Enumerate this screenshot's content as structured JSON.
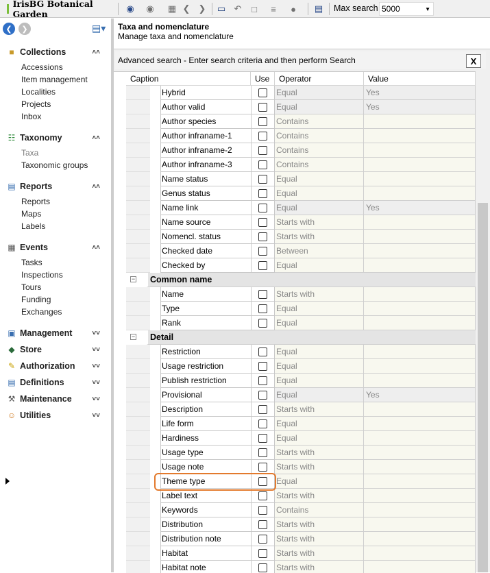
{
  "toolbar": {
    "app_title": "IrisBG Botanical Garden",
    "max_search_label": "Max search",
    "max_search_value": "5000",
    "icons": [
      "find-icon",
      "find-disabled-icon",
      "grid-icon",
      "back-icon",
      "forward-icon",
      "window-icon",
      "undo-icon",
      "save-icon",
      "export-icon",
      "user-icon",
      "settings-icon"
    ]
  },
  "sidebar": {
    "groups": [
      {
        "label": "Collections",
        "expanded": true,
        "items": [
          "Accessions",
          "Item management",
          "Localities",
          "Projects",
          "Inbox"
        ]
      },
      {
        "label": "Taxonomy",
        "expanded": true,
        "items": [
          "Taxa",
          "Taxonomic groups"
        ]
      },
      {
        "label": "Reports",
        "expanded": true,
        "items": [
          "Reports",
          "Maps",
          "Labels"
        ]
      },
      {
        "label": "Events",
        "expanded": true,
        "items": [
          "Tasks",
          "Inspections",
          "Tours",
          "Funding",
          "Exchanges"
        ]
      },
      {
        "label": "Management",
        "expanded": false
      },
      {
        "label": "Store",
        "expanded": false
      },
      {
        "label": "Authorization",
        "expanded": false
      },
      {
        "label": "Definitions",
        "expanded": false
      },
      {
        "label": "Maintenance",
        "expanded": false
      },
      {
        "label": "Utilities",
        "expanded": false
      }
    ]
  },
  "main": {
    "title": "Taxa and nomenclature",
    "subtitle": "Manage taxa and nomenclature",
    "panel_title": "Advanced search - Enter search criteria and then perform Search",
    "close_label": "X"
  },
  "grid": {
    "columns": [
      "Caption",
      "Use",
      "Operator",
      "Value"
    ],
    "rows": [
      {
        "caption": "Hybrid",
        "operator": "Equal",
        "value": "Yes"
      },
      {
        "caption": "Author valid",
        "operator": "Equal",
        "value": "Yes"
      },
      {
        "caption": "Author species",
        "operator": "Contains",
        "value": ""
      },
      {
        "caption": "Author infraname-1",
        "operator": "Contains",
        "value": ""
      },
      {
        "caption": "Author infraname-2",
        "operator": "Contains",
        "value": ""
      },
      {
        "caption": "Author infraname-3",
        "operator": "Contains",
        "value": ""
      },
      {
        "caption": "Name status",
        "operator": "Equal",
        "value": ""
      },
      {
        "caption": "Genus status",
        "operator": "Equal",
        "value": ""
      },
      {
        "caption": "Name link",
        "operator": "Equal",
        "value": "Yes"
      },
      {
        "caption": "Name source",
        "operator": "Starts with",
        "value": ""
      },
      {
        "caption": "Nomencl. status",
        "operator": "Starts with",
        "value": ""
      },
      {
        "caption": "Checked date",
        "operator": "Between",
        "value": ""
      },
      {
        "caption": "Checked by",
        "operator": "Equal",
        "value": ""
      },
      {
        "group": "Common name"
      },
      {
        "caption": "Name",
        "operator": "Starts with",
        "value": ""
      },
      {
        "caption": "Type",
        "operator": "Equal",
        "value": ""
      },
      {
        "caption": "Rank",
        "operator": "Equal",
        "value": ""
      },
      {
        "group": "Detail"
      },
      {
        "caption": "Restriction",
        "operator": "Equal",
        "value": ""
      },
      {
        "caption": "Usage restriction",
        "operator": "Equal",
        "value": ""
      },
      {
        "caption": "Publish restriction",
        "operator": "Equal",
        "value": ""
      },
      {
        "caption": "Provisional",
        "operator": "Equal",
        "value": "Yes"
      },
      {
        "caption": "Description",
        "operator": "Starts with",
        "value": ""
      },
      {
        "caption": "Life form",
        "operator": "Equal",
        "value": ""
      },
      {
        "caption": "Hardiness",
        "operator": "Equal",
        "value": ""
      },
      {
        "caption": "Usage type",
        "operator": "Starts with",
        "value": ""
      },
      {
        "caption": "Usage note",
        "operator": "Starts with",
        "value": ""
      },
      {
        "caption": "Theme type",
        "operator": "Equal",
        "value": "",
        "current": true
      },
      {
        "caption": "Label text",
        "operator": "Starts with",
        "value": ""
      },
      {
        "caption": "Keywords",
        "operator": "Contains",
        "value": ""
      },
      {
        "caption": "Distribution",
        "operator": "Starts with",
        "value": ""
      },
      {
        "caption": "Distribution note",
        "operator": "Starts with",
        "value": ""
      },
      {
        "caption": "Habitat",
        "operator": "Starts with",
        "value": ""
      },
      {
        "caption": "Habitat note",
        "operator": "Starts with",
        "value": ""
      }
    ]
  }
}
